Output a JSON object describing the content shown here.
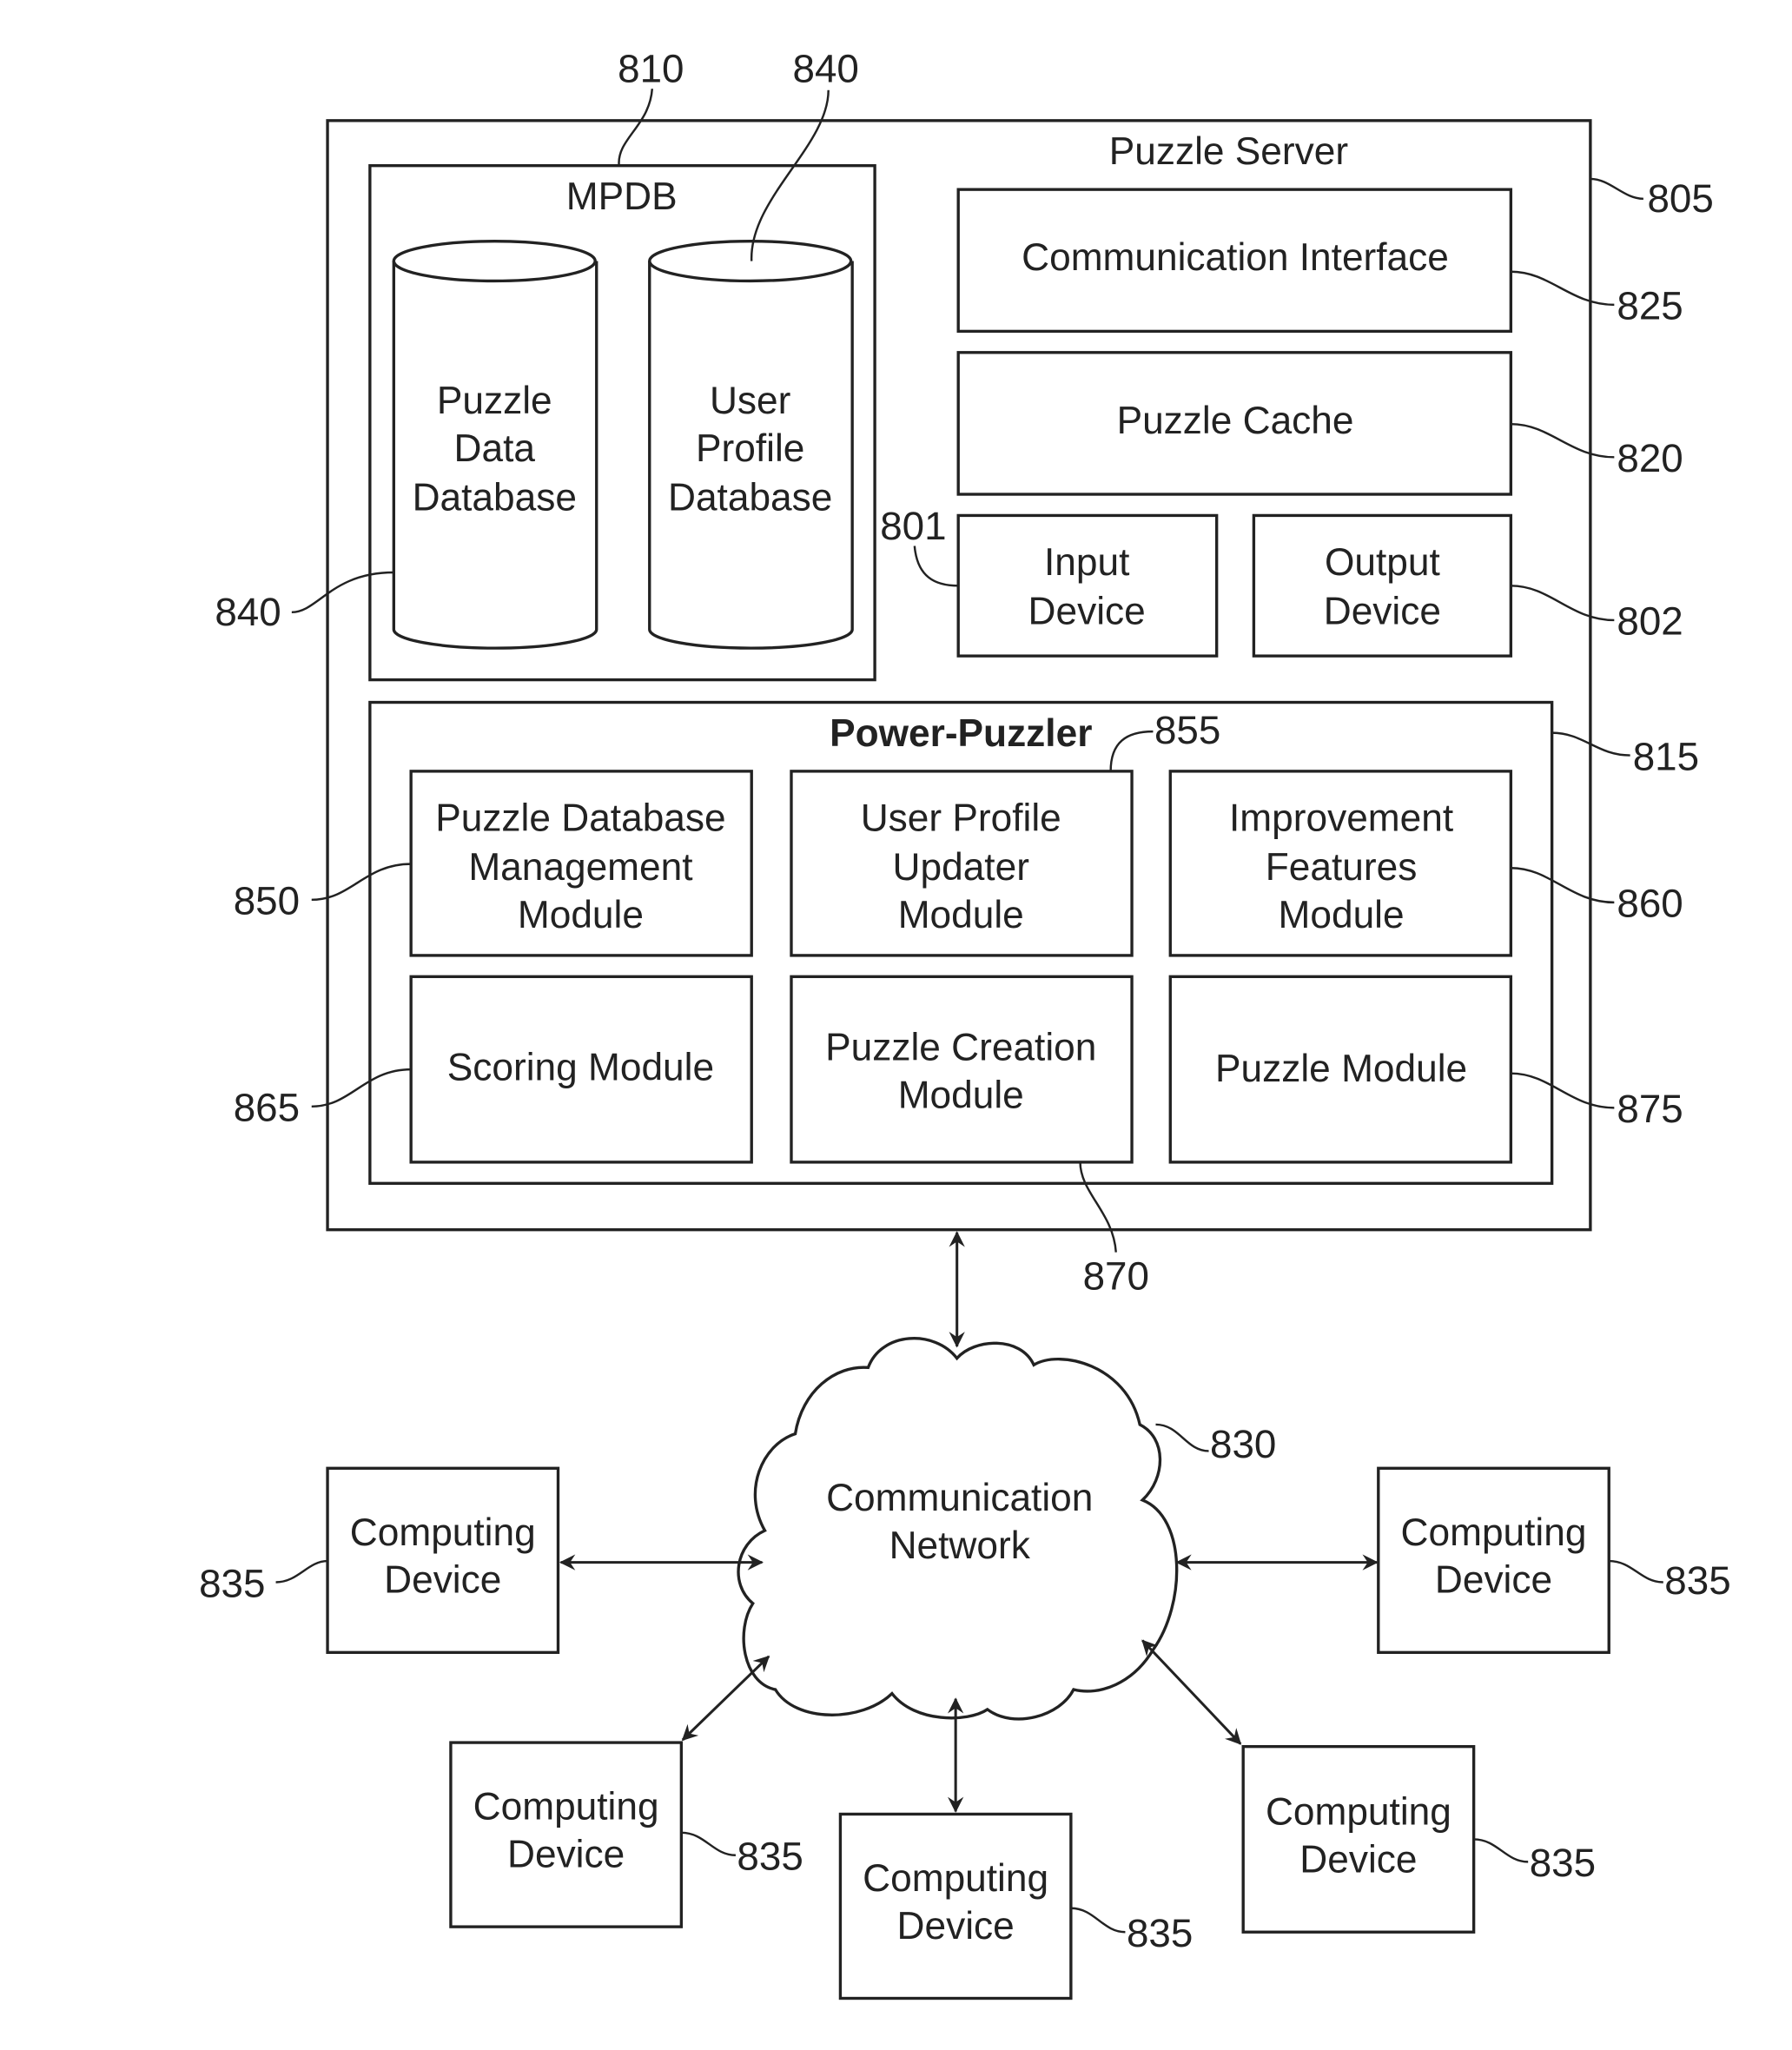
{
  "server": {
    "title": "Puzzle Server",
    "ref": "805"
  },
  "mpdb": {
    "title": "MPDB",
    "ref": "810",
    "databases": [
      {
        "lines": [
          "Puzzle",
          "Data",
          "Database"
        ],
        "ref": "840"
      },
      {
        "lines": [
          "User",
          "Profile",
          "Database"
        ],
        "ref": "840"
      }
    ]
  },
  "communication_interface": {
    "label": "Communication Interface",
    "ref": "825"
  },
  "puzzle_cache": {
    "label": "Puzzle Cache",
    "ref": "820"
  },
  "input_device": {
    "lines": [
      "Input",
      "Device"
    ],
    "ref": "801"
  },
  "output_device": {
    "lines": [
      "Output",
      "Device"
    ],
    "ref": "802"
  },
  "power_puzzler": {
    "title": "Power-Puzzler",
    "ref": "815",
    "modules": [
      {
        "lines": [
          "Puzzle Database",
          "Management",
          "Module"
        ],
        "ref": "850"
      },
      {
        "lines": [
          "User Profile",
          "Updater",
          "Module"
        ],
        "ref": "855"
      },
      {
        "lines": [
          "Improvement",
          "Features",
          "Module"
        ],
        "ref": "860"
      },
      {
        "lines": [
          "Scoring Module"
        ],
        "ref": "865"
      },
      {
        "lines": [
          "Puzzle Creation",
          "Module"
        ],
        "ref": "870"
      },
      {
        "lines": [
          "Puzzle Module"
        ],
        "ref": "875"
      }
    ]
  },
  "network": {
    "lines": [
      "Communication",
      "Network"
    ],
    "ref": "830"
  },
  "computing_devices": [
    {
      "lines": [
        "Computing",
        "Device"
      ],
      "ref": "835"
    },
    {
      "lines": [
        "Computing",
        "Device"
      ],
      "ref": "835"
    },
    {
      "lines": [
        "Computing",
        "Device"
      ],
      "ref": "835"
    },
    {
      "lines": [
        "Computing",
        "Device"
      ],
      "ref": "835"
    },
    {
      "lines": [
        "Computing",
        "Device"
      ],
      "ref": "835"
    }
  ]
}
